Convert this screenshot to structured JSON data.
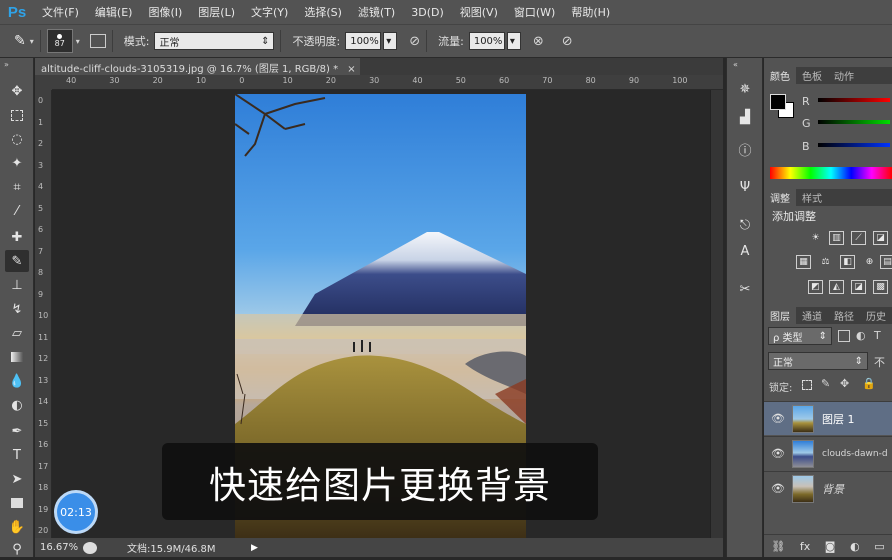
{
  "app": {
    "logo": "Ps"
  },
  "menu": [
    "文件(F)",
    "编辑(E)",
    "图像(I)",
    "图层(L)",
    "文字(Y)",
    "选择(S)",
    "滤镜(T)",
    "3D(D)",
    "视图(V)",
    "窗口(W)",
    "帮助(H)"
  ],
  "options": {
    "brush_size": "87",
    "mode_label": "模式:",
    "mode_value": "正常",
    "opacity_label": "不透明度:",
    "opacity_value": "100%",
    "flow_label": "流量:",
    "flow_value": "100%"
  },
  "document": {
    "tab_title": "altitude-cliff-clouds-3105319.jpg @ 16.7% (图层 1, RGB/8) *",
    "close_glyph": "×",
    "ruler_top": [
      "40",
      "30",
      "20",
      "10",
      "0",
      "10",
      "20",
      "30",
      "40",
      "50",
      "60",
      "70",
      "80",
      "90",
      "100"
    ],
    "ruler_left": [
      "0",
      "1",
      "2",
      "3",
      "4",
      "5",
      "6",
      "7",
      "8",
      "9",
      "10",
      "11",
      "12",
      "13",
      "14",
      "15",
      "16",
      "17",
      "18",
      "19",
      "20"
    ]
  },
  "status": {
    "zoom": "16.67%",
    "doc_size": "文档:15.9M/46.8M"
  },
  "panels": {
    "color_tabs": [
      "颜色",
      "色板",
      "动作"
    ],
    "channels": [
      "R",
      "G",
      "B"
    ],
    "adjust_tabs": [
      "调整",
      "样式"
    ],
    "adjust_title": "添加调整",
    "layer_tabs": [
      "图层",
      "通道",
      "路径",
      "历史"
    ],
    "kind_label": "ρ 类型",
    "blend_mode": "正常",
    "opacity_short": "不",
    "lock_label": "锁定:",
    "layers": [
      {
        "name": "图层 1",
        "selected": true
      },
      {
        "name": "clouds-dawn-d",
        "selected": false
      },
      {
        "name": "背景",
        "selected": false
      }
    ]
  },
  "overlay": {
    "caption": "快速给图片更换背景",
    "timer": "02:13"
  },
  "colors": {
    "accent": "#2fa3e8",
    "selected_layer": "#5f6e85",
    "timer_blue": "#3a8ee8"
  }
}
